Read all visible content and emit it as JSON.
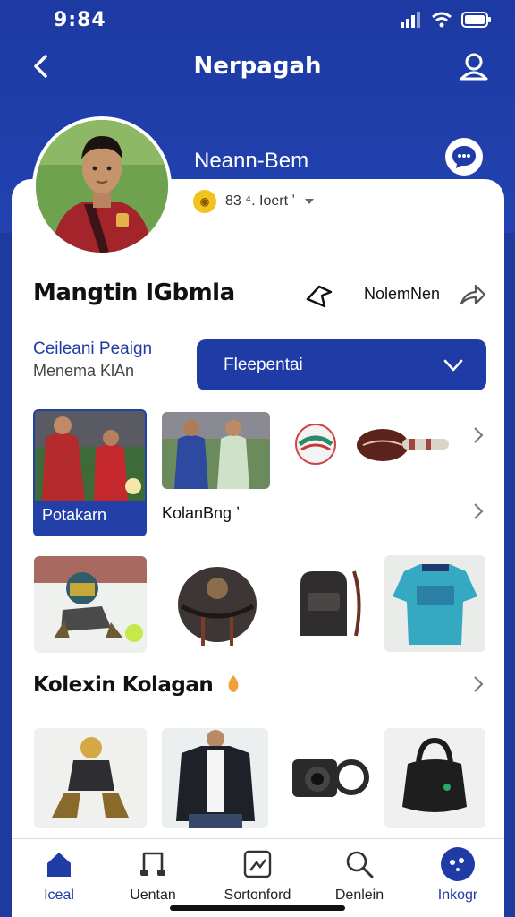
{
  "status": {
    "time": "9:84"
  },
  "nav": {
    "title": "Nerpagah"
  },
  "profile": {
    "header_name": "Neann-Bem",
    "meta_text": "83 ⁴. Ioert ʼ",
    "display_name": "Mangtin IGbmla",
    "follow_label": "NolemNen"
  },
  "info": {
    "label": "Ceileani Peaign",
    "sub": "Menema KlAn",
    "select_label": "Fleepentai"
  },
  "tiles": {
    "featured_label": "Potakarn",
    "second_label": "KolanBng ʼ"
  },
  "section": {
    "title": "Kolexin Kolagan"
  },
  "bottom_nav": [
    {
      "label": "Iceal"
    },
    {
      "label": "Uentan"
    },
    {
      "label": "Sortonford"
    },
    {
      "label": "Denlein"
    },
    {
      "label": "Inkogr"
    }
  ],
  "colors": {
    "brand": "#1f3ba6",
    "header": "#2142b0",
    "accent": "#f2c21f"
  }
}
